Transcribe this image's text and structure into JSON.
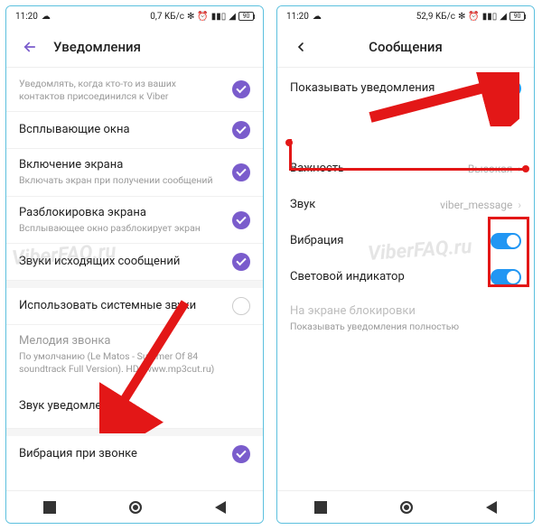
{
  "watermark": "ViberFAQ.ru",
  "phone1": {
    "status": {
      "time": "11:20",
      "speed": "0,7 KБ/c",
      "battery": "90"
    },
    "header": {
      "title": "Уведомления"
    },
    "rows": {
      "joined_sub": "Уведомлять, когда кто-то из ваших контактов присоединился к Viber",
      "popup": "Всплывающие окна",
      "screen_on": "Включение экрана",
      "screen_on_sub": "Включать экран при получении сообщений",
      "unlock": "Разблокировка экрана",
      "unlock_sub": "Всплывающее окно разблокирует экран",
      "out_sounds": "Звуки исходящих сообщений",
      "sys_sounds": "Использовать системные звуки",
      "ringtone": "Мелодия звонка",
      "ringtone_sub": "По умолчанию (Le Matos - Summer Of 84 soundtrack Full Version). HD (www.mp3cut.ru)",
      "notif_sound": "Звук уведомления",
      "vibrate_call": "Вибрация при звонке"
    }
  },
  "phone2": {
    "status": {
      "time": "11:20",
      "speed": "52,9 KБ/c",
      "battery": "90"
    },
    "header": {
      "title": "Сообщения"
    },
    "rows": {
      "show_notif": "Показывать уведомления",
      "importance": "Важность",
      "importance_val": "Высокая",
      "sound": "Звук",
      "sound_val": "viber_message",
      "vibration": "Вибрация",
      "led": "Световой индикатор",
      "lockscreen": "На экране блокировки",
      "lockscreen_sub": "Показывать уведомления полностью"
    }
  }
}
